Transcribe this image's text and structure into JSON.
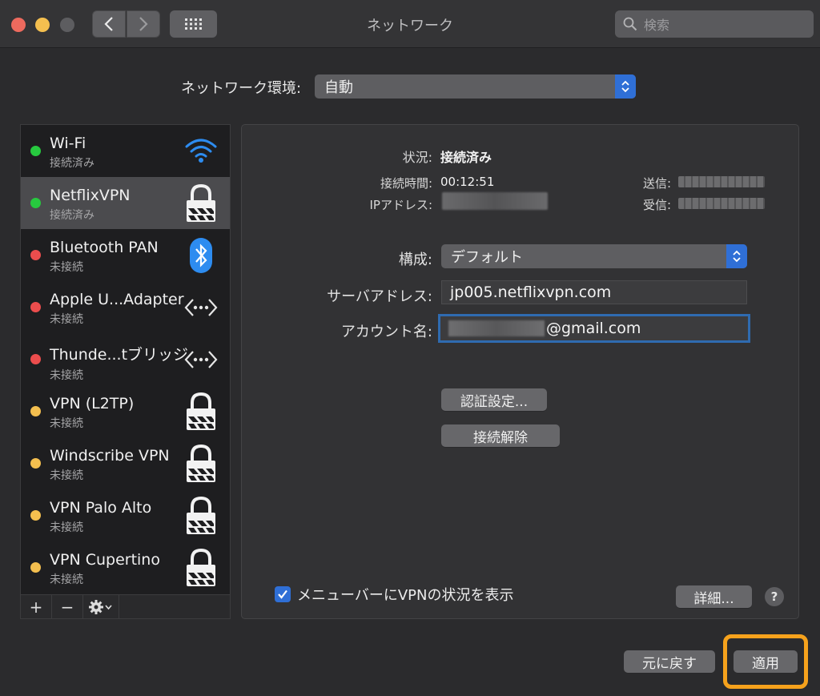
{
  "window": {
    "title": "ネットワーク",
    "search_placeholder": "検索"
  },
  "location": {
    "label": "ネットワーク環境:",
    "value": "自動"
  },
  "services": [
    {
      "name": "Wi-Fi",
      "status": "接続済み",
      "dot_color": "#27c93f",
      "icon": "wifi-icon"
    },
    {
      "name": "NetflixVPN",
      "status": "接続済み",
      "dot_color": "#27c93f",
      "icon": "lock-icon"
    },
    {
      "name": "Bluetooth PAN",
      "status": "未接続",
      "dot_color": "#ec4d4d",
      "icon": "bluetooth-icon"
    },
    {
      "name": "Apple U...Adapter",
      "status": "未接続",
      "dot_color": "#ec4d4d",
      "icon": "ethernet-icon"
    },
    {
      "name": "Thunde...tブリッジ",
      "status": "未接続",
      "dot_color": "#ec4d4d",
      "icon": "ethernet-icon"
    },
    {
      "name": "VPN (L2TP)",
      "status": "未接続",
      "dot_color": "#f4bf4f",
      "icon": "lock-icon"
    },
    {
      "name": "Windscribe VPN",
      "status": "未接続",
      "dot_color": "#f4bf4f",
      "icon": "lock-icon"
    },
    {
      "name": "VPN Palo Alto",
      "status": "未接続",
      "dot_color": "#f4bf4f",
      "icon": "lock-icon"
    },
    {
      "name": "VPN Cupertino",
      "status": "未接続",
      "dot_color": "#f4bf4f",
      "icon": "lock-icon"
    }
  ],
  "sidebar_tools": {
    "add": "+",
    "remove": "−"
  },
  "detail": {
    "status_label": "状況:",
    "status_value": "接続済み",
    "connect_time_label": "接続時間:",
    "connect_time_value": "00:12:51",
    "ip_label": "IPアドレス:",
    "sent_label": "送信:",
    "received_label": "受信:",
    "config_label": "構成:",
    "config_value": "デフォルト",
    "server_label": "サーバアドレス:",
    "server_value": "jp005.netflixvpn.com",
    "account_label": "アカウント名:",
    "account_value": "@gmail.com",
    "auth_button": "認証設定...",
    "disconnect_button": "接続解除",
    "show_status_checkbox": "メニューバーにVPNの状況を表示",
    "advanced_button": "詳細...",
    "help_button": "?"
  },
  "footer": {
    "revert_button": "元に戻す",
    "apply_button": "適用"
  },
  "colors": {
    "accent": "#2f6fd6",
    "highlight": "#f6a21c"
  }
}
